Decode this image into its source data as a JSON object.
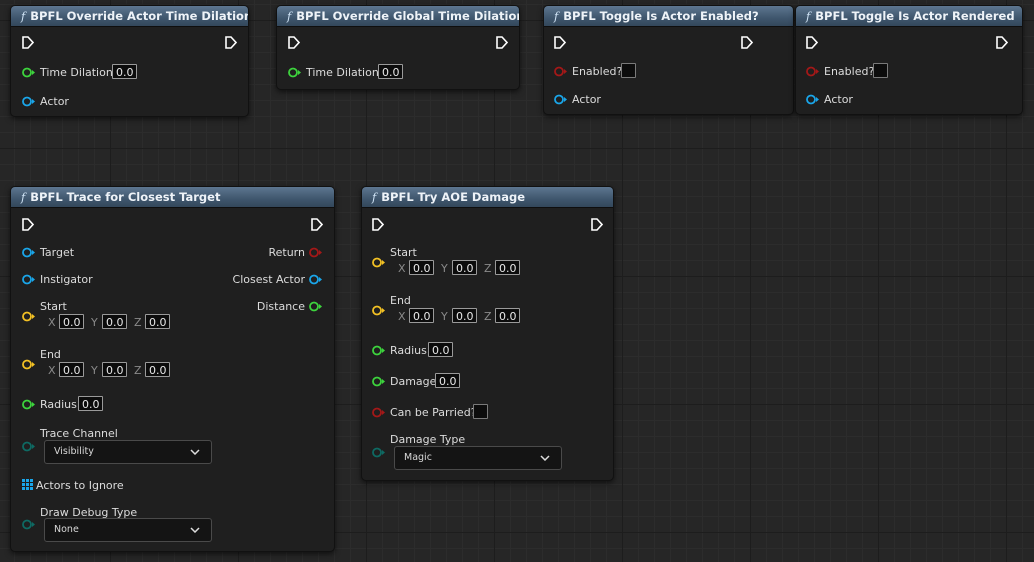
{
  "nodes": {
    "override_actor": {
      "title": "BPFL Override Actor Time Dilation",
      "time_dilation_label": "Time Dilation",
      "time_dilation_value": "0.0",
      "actor_label": "Actor"
    },
    "override_global": {
      "title": "BPFL Override Global Time Dilation",
      "time_dilation_label": "Time Dilation",
      "time_dilation_value": "0.0"
    },
    "toggle_enabled": {
      "title": "BPFL Toggle Is Actor Enabled?",
      "enabled_label": "Enabled?",
      "actor_label": "Actor"
    },
    "toggle_rendered": {
      "title": "BPFL Toggle Is Actor Rendered",
      "enabled_label": "Enabled?",
      "actor_label": "Actor"
    },
    "trace": {
      "title": "BPFL Trace for Closest Target",
      "target_label": "Target",
      "instigator_label": "Instigator",
      "start_label": "Start",
      "end_label": "End",
      "x": "X",
      "y": "Y",
      "z": "Z",
      "start": {
        "x": "0.0",
        "y": "0.0",
        "z": "0.0"
      },
      "end": {
        "x": "0.0",
        "y": "0.0",
        "z": "0.0"
      },
      "radius_label": "Radius",
      "radius_value": "0.0",
      "trace_channel_label": "Trace Channel",
      "trace_channel_value": "Visibility",
      "actors_to_ignore_label": "Actors to Ignore",
      "draw_debug_label": "Draw Debug Type",
      "draw_debug_value": "None",
      "return_label": "Return",
      "closest_actor_label": "Closest Actor",
      "distance_label": "Distance"
    },
    "aoe": {
      "title": "BPFL Try AOE Damage",
      "start_label": "Start",
      "end_label": "End",
      "x": "X",
      "y": "Y",
      "z": "Z",
      "start": {
        "x": "0.0",
        "y": "0.0",
        "z": "0.0"
      },
      "end": {
        "x": "0.0",
        "y": "0.0",
        "z": "0.0"
      },
      "radius_label": "Radius",
      "radius_value": "0.0",
      "damage_label": "Damage",
      "damage_value": "0.0",
      "parried_label": "Can be Parried?",
      "damage_type_label": "Damage Type",
      "damage_type_value": "Magic"
    }
  },
  "colors": {
    "float_pin": "#3dd43d",
    "object_pin": "#1aa6ea",
    "bool_pin": "#a41818",
    "vector_pin": "#f3c124",
    "enum_pin": "#0e6a63",
    "exec_pin": "#ffffff",
    "header": "#4a627a"
  }
}
